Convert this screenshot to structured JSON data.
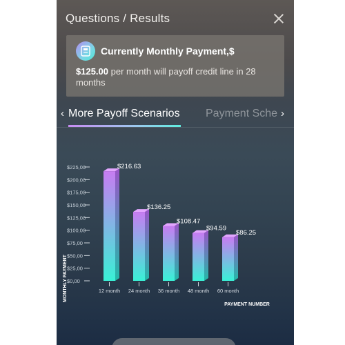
{
  "header": {
    "title": "Questions / Results"
  },
  "card": {
    "title": "Currently Monthly Payment,$",
    "amount": "$125.00",
    "text": " per month will payoff credit line in 28 months",
    "icon": "payment-card-icon"
  },
  "tabs": {
    "prev_icon": "‹",
    "next_icon": "›",
    "active": "More Payoff Scenarios",
    "next": "Payment Sche"
  },
  "colors": {
    "bar_top": "#c77cf2",
    "bar_bottom": "#39f1d6",
    "text": "#ffffff"
  },
  "chart_data": {
    "type": "bar",
    "categories": [
      "12 month",
      "24 month",
      "36 month",
      "48 month",
      "60 month"
    ],
    "values": [
      216.63,
      136.25,
      108.47,
      94.59,
      86.25
    ],
    "value_labels": [
      "$216.63",
      "$136.25",
      "$108.47",
      "$94.59",
      "$86.25"
    ],
    "ylabel": "MONTHLY PAYMENT",
    "xlabel": "PAYMENT NUMBER",
    "yticks": [
      0,
      25,
      50,
      75,
      100,
      125,
      150,
      175,
      200,
      225
    ],
    "ytick_labels": [
      "$0,00",
      "$25,00",
      "$50,00",
      "$75,00",
      "$100,00",
      "$125,00",
      "$150,00",
      "$175,00",
      "$200,00",
      "$225,00"
    ],
    "ylim": [
      0,
      225
    ],
    "grid": false,
    "legend": "none"
  }
}
